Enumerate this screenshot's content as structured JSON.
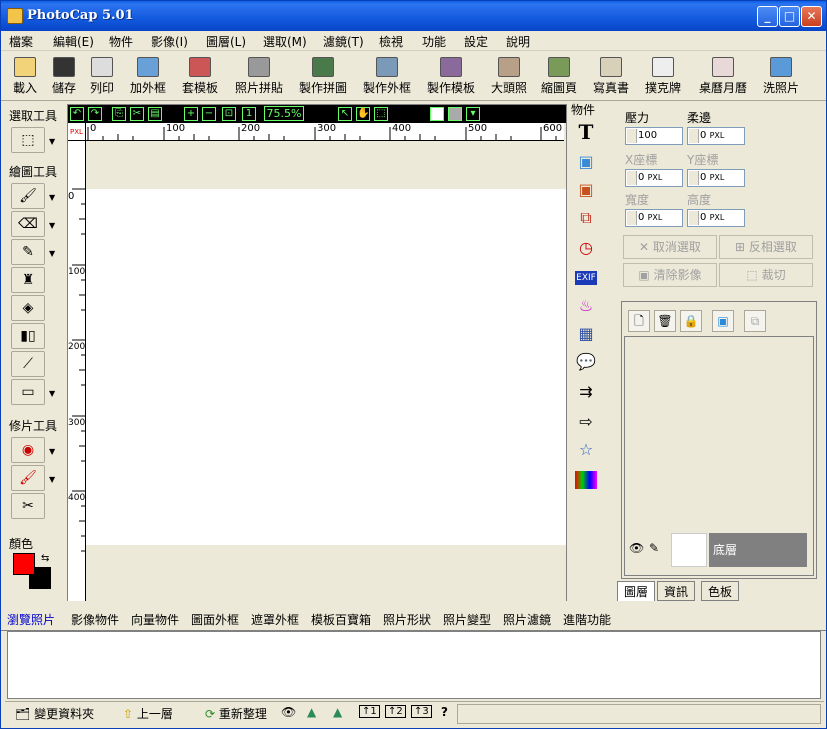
{
  "title": "PhotoCap 5.01",
  "window_buttons": {
    "minimize": "_",
    "maximize": "□",
    "close": "✕"
  },
  "menu": [
    "檔案",
    "編輯(E)",
    "物件",
    "影像(I)",
    "圖層(L)",
    "選取(M)",
    "濾鏡(T)",
    "檢視",
    "功能",
    "設定",
    "說明"
  ],
  "toolbar": [
    {
      "label": "載入",
      "icon": "open-folder-icon"
    },
    {
      "label": "儲存",
      "icon": "save-disk-icon"
    },
    {
      "label": "列印",
      "icon": "printer-icon"
    },
    {
      "label": "加外框",
      "icon": "add-frame-icon"
    },
    {
      "label": "套模板",
      "icon": "template-icon"
    },
    {
      "label": "照片拼貼",
      "icon": "photo-collage-icon"
    },
    {
      "label": "製作拼圖",
      "icon": "puzzle-icon"
    },
    {
      "label": "製作外框",
      "icon": "make-frame-icon"
    },
    {
      "label": "製作模板",
      "icon": "make-template-icon"
    },
    {
      "label": "大頭照",
      "icon": "id-photo-icon"
    },
    {
      "label": "縮圖頁",
      "icon": "thumbnail-page-icon"
    },
    {
      "label": "寫真書",
      "icon": "photo-book-icon"
    },
    {
      "label": "撲克牌",
      "icon": "playing-cards-icon"
    },
    {
      "label": "桌曆月曆",
      "icon": "calendar-icon"
    },
    {
      "label": "洗照片",
      "icon": "print-photo-icon"
    }
  ],
  "left_panel": {
    "select_tools": "選取工具",
    "draw_tools": "繪圖工具",
    "retouch_tools": "修片工具",
    "color": "顏色",
    "fg_color": "#ff0000",
    "bg_color": "#000000"
  },
  "canvas": {
    "zoom": "75.5%",
    "unit": "PXL",
    "h_ticks": [
      "0",
      "100",
      "200",
      "300",
      "400",
      "500",
      "600"
    ],
    "v_ticks": [
      "0",
      "100",
      "200",
      "300",
      "400"
    ]
  },
  "object_panel_label": "物件",
  "props": {
    "pressure_label": "壓力",
    "pressure_value": "100",
    "softness_label": "柔邊",
    "softness_value": "0",
    "x_label": "X座標",
    "x_value": "0",
    "y_label": "Y座標",
    "y_value": "0",
    "width_label": "寬度",
    "width_value": "0",
    "height_label": "高度",
    "height_value": "0",
    "unit": "PXL",
    "cancel_select": "取消選取",
    "invert_select": "反相選取",
    "clear_image": "清除影像",
    "crop": "裁切"
  },
  "layer": {
    "name": "底層"
  },
  "right_tabs": [
    "圖層",
    "資訊",
    "色板"
  ],
  "bottom_tabs": [
    "瀏覽照片",
    "影像物件",
    "向量物件",
    "圖面外框",
    "遮罩外框",
    "模板百寶箱",
    "照片形狀",
    "照片變型",
    "照片濾鏡",
    "進階功能"
  ],
  "status": {
    "change_folder": "變更資料夾",
    "up_level": "上一層",
    "refresh": "重新整理",
    "help": "?"
  }
}
